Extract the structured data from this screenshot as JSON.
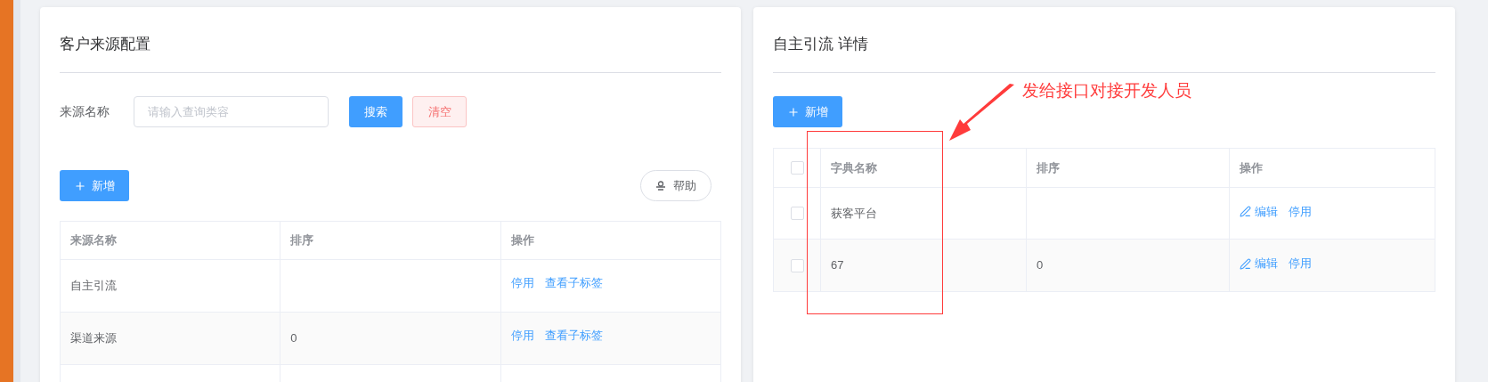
{
  "left_panel": {
    "title": "客户来源配置",
    "filter": {
      "label": "来源名称",
      "placeholder": "请输入查询类容"
    },
    "search_button": "搜索",
    "clear_button": "清空",
    "add_button": "新增",
    "help_button": "帮助",
    "table": {
      "columns": [
        "来源名称",
        "排序",
        "操作"
      ],
      "rows": [
        {
          "cells": [
            "自主引流",
            ""
          ],
          "actions": [
            {
              "label": "停用",
              "kind": "link"
            },
            {
              "label": "查看子标签",
              "kind": "link"
            }
          ]
        },
        {
          "cells": [
            "渠道来源",
            "0"
          ],
          "actions": [
            {
              "label": "停用",
              "kind": "link"
            },
            {
              "label": "查看子标签",
              "kind": "link"
            }
          ]
        }
      ]
    }
  },
  "right_panel": {
    "title": "自主引流 详情",
    "add_button": "新增",
    "table": {
      "select_all_checked": false,
      "columns": [
        "字典名称",
        "排序",
        "操作"
      ],
      "rows": [
        {
          "checked": false,
          "cells": [
            "获客平台",
            ""
          ],
          "actions": [
            {
              "label": "编辑",
              "kind": "edit"
            },
            {
              "label": "停用",
              "kind": "link"
            }
          ]
        },
        {
          "checked": false,
          "cells": [
            "67",
            "0"
          ],
          "actions": [
            {
              "label": "编辑",
              "kind": "edit"
            },
            {
              "label": "停用",
              "kind": "link"
            }
          ]
        }
      ]
    }
  },
  "annotation": {
    "text": "发给接口对接开发人员"
  }
}
